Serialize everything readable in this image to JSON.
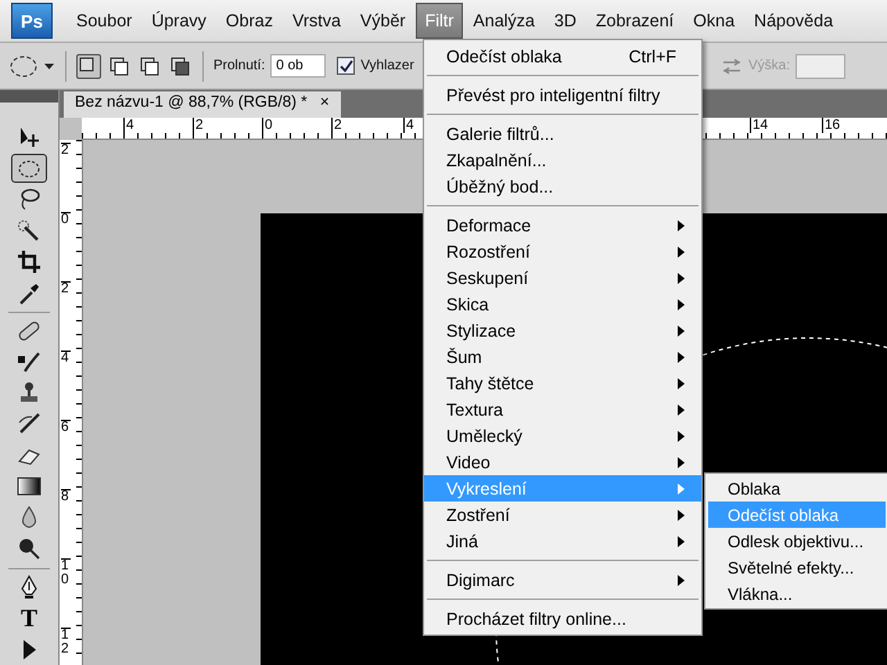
{
  "app_logo": {
    "text": "Ps"
  },
  "menubar": [
    {
      "label": "Soubor",
      "selected": false
    },
    {
      "label": "Úpravy",
      "selected": false
    },
    {
      "label": "Obraz",
      "selected": false
    },
    {
      "label": "Vrstva",
      "selected": false
    },
    {
      "label": "Výběr",
      "selected": false
    },
    {
      "label": "Filtr",
      "selected": true
    },
    {
      "label": "Analýza",
      "selected": false
    },
    {
      "label": "3D",
      "selected": false
    },
    {
      "label": "Zobrazení",
      "selected": false
    },
    {
      "label": "Okna",
      "selected": false
    },
    {
      "label": "Nápověda",
      "selected": false
    }
  ],
  "options_bar": {
    "selection_modes": [
      {
        "selected": true
      },
      {
        "selected": false
      },
      {
        "selected": false
      },
      {
        "selected": false
      }
    ],
    "feather_label": "Prolnutí:",
    "feather_value": "0 ob",
    "antialias": {
      "label": "Vyhlazer",
      "checked": true
    },
    "height_label": "Výška:"
  },
  "document_tab": {
    "title": "Bez názvu-1 @ 88,7% (RGB/8) *",
    "close": "×"
  },
  "top_ruler": [
    "4",
    "2",
    "0",
    "2",
    "4",
    "14",
    "16"
  ],
  "left_ruler": [
    "2",
    "0",
    "2",
    "4",
    "6",
    "8",
    "10",
    "12"
  ],
  "tools": [
    {
      "selected": false
    },
    {
      "selected": true
    },
    {
      "selected": false
    },
    {
      "selected": false
    },
    {
      "selected": false
    },
    {
      "selected": false
    },
    {
      "selected": false
    },
    {
      "selected": false
    },
    {
      "selected": false
    },
    {
      "selected": false
    },
    {
      "selected": false
    },
    {
      "selected": false
    },
    {
      "selected": false
    },
    {
      "selected": false
    },
    {
      "selected": false
    },
    {
      "selected": false,
      "glyph": "T"
    },
    {
      "selected": false
    }
  ],
  "filter_menu": [
    {
      "kind": "item",
      "label": "Odečíst oblaka",
      "shortcut": "Ctrl+F",
      "selected": false
    },
    {
      "kind": "separator"
    },
    {
      "kind": "item",
      "label": "Převést pro inteligentní filtry",
      "selected": false
    },
    {
      "kind": "separator"
    },
    {
      "kind": "item",
      "label": "Galerie filtrů...",
      "selected": false
    },
    {
      "kind": "item",
      "label": "Zkapalnění...",
      "selected": false
    },
    {
      "kind": "item",
      "label": "Úběžný bod...",
      "selected": false
    },
    {
      "kind": "separator"
    },
    {
      "kind": "submenu",
      "label": "Deformace",
      "selected": false
    },
    {
      "kind": "submenu",
      "label": "Rozostření",
      "selected": false
    },
    {
      "kind": "submenu",
      "label": "Seskupení",
      "selected": false
    },
    {
      "kind": "submenu",
      "label": "Skica",
      "selected": false
    },
    {
      "kind": "submenu",
      "label": "Stylizace",
      "selected": false
    },
    {
      "kind": "submenu",
      "label": "Šum",
      "selected": false
    },
    {
      "kind": "submenu",
      "label": "Tahy štětce",
      "selected": false
    },
    {
      "kind": "submenu",
      "label": "Textura",
      "selected": false
    },
    {
      "kind": "submenu",
      "label": "Umělecký",
      "selected": false
    },
    {
      "kind": "submenu",
      "label": "Video",
      "selected": false
    },
    {
      "kind": "submenu",
      "label": "Vykreslení",
      "selected": true
    },
    {
      "kind": "submenu",
      "label": "Zostření",
      "selected": false
    },
    {
      "kind": "submenu",
      "label": "Jiná",
      "selected": false
    },
    {
      "kind": "separator"
    },
    {
      "kind": "submenu",
      "label": "Digimarc",
      "selected": false
    },
    {
      "kind": "separator"
    },
    {
      "kind": "item",
      "label": "Procházet filtry online...",
      "selected": false
    }
  ],
  "render_submenu": [
    {
      "label": "Oblaka",
      "selected": false
    },
    {
      "label": "Odečíst oblaka",
      "selected": true
    },
    {
      "label": "Odlesk objektivu...",
      "selected": false
    },
    {
      "label": "Světelné efekty...",
      "selected": false
    },
    {
      "label": "Vlákna...",
      "selected": false
    }
  ]
}
